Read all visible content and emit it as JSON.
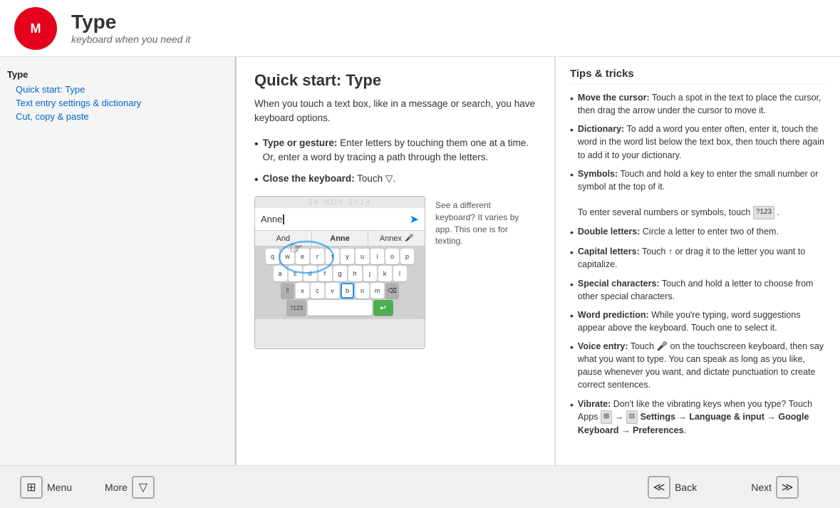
{
  "header": {
    "logo_alt": "Motorola logo",
    "title": "Type",
    "subtitle": "keyboard when you need it"
  },
  "sidebar": {
    "items": [
      {
        "label": "Type",
        "level": "top"
      },
      {
        "label": "Quick start: Type",
        "level": "sub"
      },
      {
        "label": "Text entry settings & dictionary",
        "level": "sub"
      },
      {
        "label": "Cut, copy & paste",
        "level": "sub"
      }
    ]
  },
  "content": {
    "title": "Quick start: Type",
    "intro": "When you touch a text box, like in a message or search, you have keyboard options.",
    "bullets": [
      {
        "term": "Type or gesture:",
        "text": " Enter letters by touching them one at a time. Or, enter a word by tracing a path through the letters."
      },
      {
        "term": "Close the keyboard:",
        "text": " Touch ▽."
      }
    ],
    "keyboard_date": "24 NOV 2014",
    "keyboard_input_text": "Anne",
    "keyboard_suggestions": [
      "And",
      "Anne",
      "Annex"
    ],
    "keyboard_rows": [
      [
        "q",
        "w",
        "e",
        "r",
        "t",
        "y",
        "u",
        "i",
        "o",
        "p"
      ],
      [
        "a",
        "s",
        "d",
        "f",
        "g",
        "h",
        "j",
        "k",
        "l"
      ],
      [
        "⇧",
        "x",
        "c",
        "v",
        "b",
        "n",
        "m",
        "⌫"
      ],
      [
        "?123",
        "",
        "",
        "",
        "",
        "",
        "",
        "",
        "",
        "↵"
      ]
    ],
    "caption": "See a different keyboard? It varies by app. This one is for texting."
  },
  "tips": {
    "title": "Tips & tricks",
    "items": [
      {
        "term": "Move the cursor:",
        "text": " Touch a spot in the text to place the cursor, then drag the arrow under the cursor to move it."
      },
      {
        "term": "Dictionary:",
        "text": " To add a word you enter often, enter it, touch the word in the word list below the text box, then touch there again to add it to your dictionary."
      },
      {
        "term": "Symbols:",
        "text": " Touch and hold a key to enter the small number or symbol at the top of it.",
        "extra": "To enter several numbers or symbols, touch  ?123 ."
      },
      {
        "term": "Double letters:",
        "text": " Circle a letter to enter two of them."
      },
      {
        "term": "Capital letters:",
        "text": " Touch ↑ or drag it to the letter you want to capitalize."
      },
      {
        "term": "Special characters:",
        "text": " Touch and hold a letter to choose from other special characters."
      },
      {
        "term": "Word prediction:",
        "text": " While you're typing, word suggestions appear above the keyboard. Touch one to select it."
      },
      {
        "term": "Voice entry:",
        "text": " Touch 🎤 on the touchscreen keyboard, then say what you want to type. You can speak as long as you like, pause whenever you want, and dictate punctuation to create correct sentences."
      },
      {
        "term": "Vibrate:",
        "text": " Don't like the vibrating keys when you type? Touch Apps  □  →  □  Settings → Language & input → Google Keyboard → Preferences."
      }
    ]
  },
  "footer": {
    "menu_label": "Menu",
    "menu_icon": "⊞",
    "more_label": "More",
    "more_icon": "▽",
    "back_label": "Back",
    "back_icon": "≪",
    "next_label": "Next",
    "next_icon": "≫"
  }
}
